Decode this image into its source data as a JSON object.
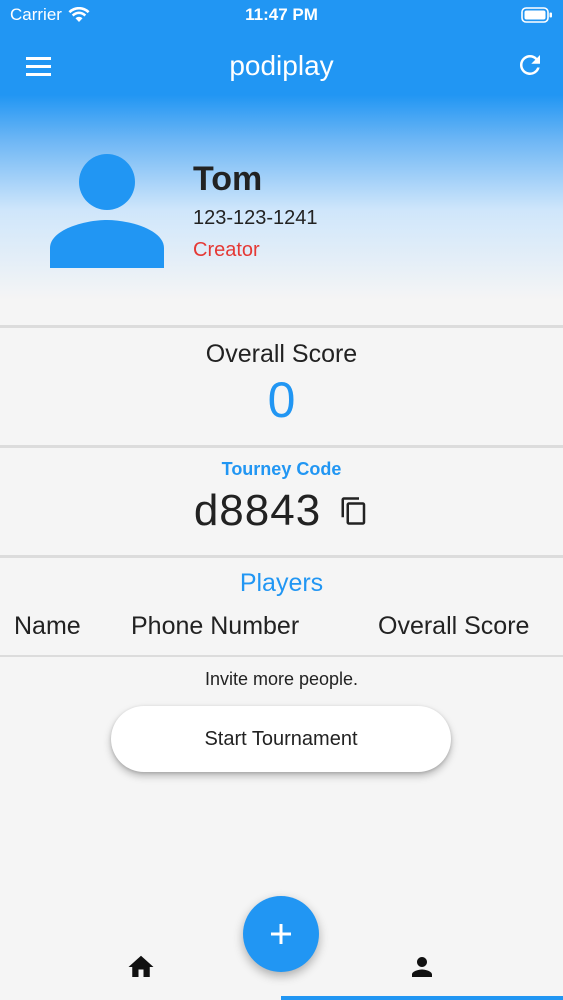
{
  "status_bar": {
    "carrier": "Carrier",
    "time": "11:47 PM",
    "icons": [
      "wifi-icon",
      "battery-icon"
    ]
  },
  "app_bar": {
    "title": "podiplay",
    "left_icon": "menu-icon",
    "right_icon": "refresh-icon"
  },
  "profile": {
    "name": "Tom",
    "phone": "123-123-1241",
    "role": "Creator",
    "avatar_icon": "person-icon"
  },
  "score": {
    "label": "Overall Score",
    "value": "0"
  },
  "tourney": {
    "label": "Tourney Code",
    "code": "d8843",
    "copy_icon": "copy-icon"
  },
  "players": {
    "label": "Players",
    "columns": [
      "Name",
      "Phone Number",
      "Overall Score"
    ],
    "empty_text": "Invite more people."
  },
  "actions": {
    "start_label": "Start Tournament",
    "fab_icon": "plus-icon"
  },
  "bottom_nav": {
    "items": [
      "home-icon",
      "person-icon"
    ],
    "selected_index": 1
  },
  "colors": {
    "accent": "#2196f3",
    "role": "#e53935",
    "background": "#f5f5f5"
  }
}
